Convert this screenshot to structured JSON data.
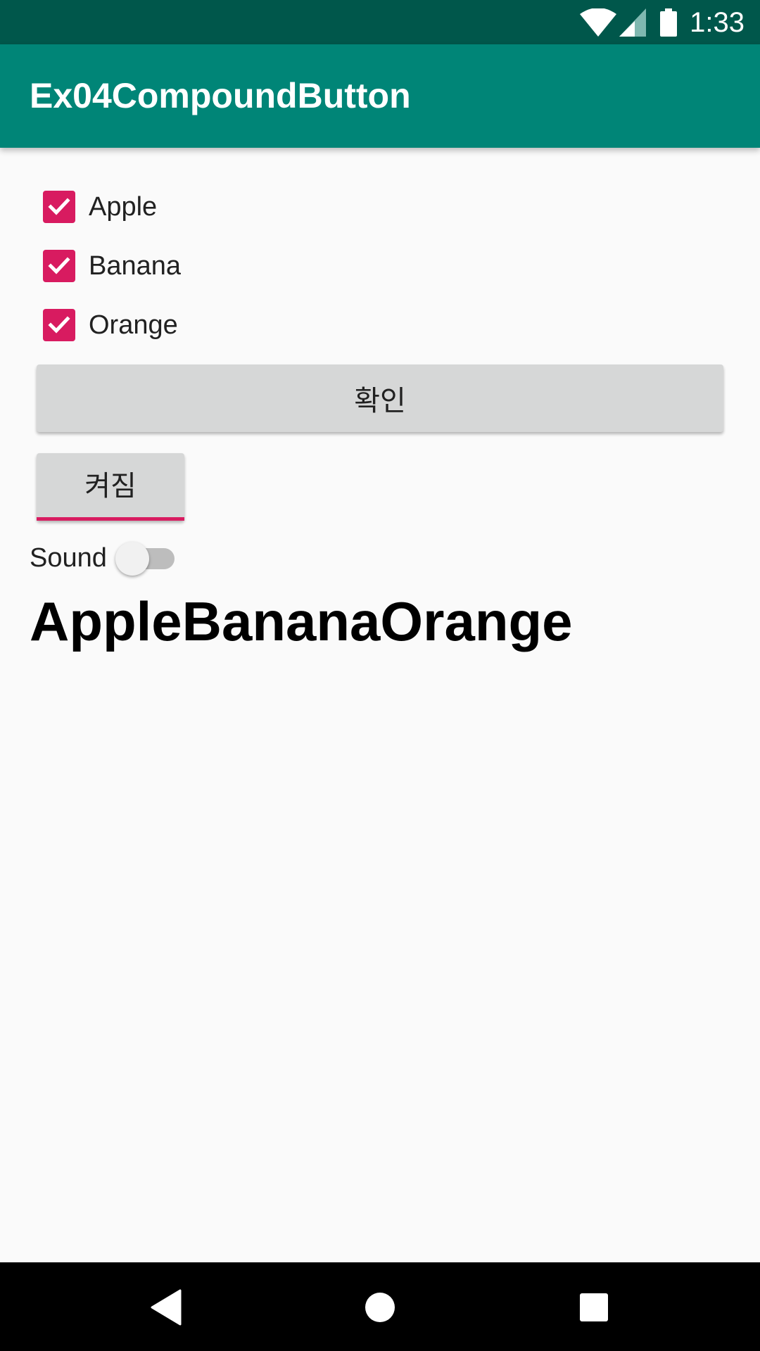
{
  "status_bar": {
    "time": "1:33",
    "icons": [
      "wifi-icon",
      "cell-signal-icon",
      "battery-icon"
    ],
    "color": "#00574b"
  },
  "app_bar": {
    "title": "Ex04CompoundButton",
    "color": "#008577"
  },
  "checkboxes": [
    {
      "label": "Apple",
      "checked": true
    },
    {
      "label": "Banana",
      "checked": true
    },
    {
      "label": "Orange",
      "checked": true
    }
  ],
  "confirm_button": {
    "label": "확인"
  },
  "toggle_button": {
    "label": "켜짐",
    "checked": true
  },
  "switch": {
    "label": "Sound",
    "checked": false
  },
  "result_text": "AppleBananaOrange",
  "accent_color": "#d81b60",
  "nav_bar": {
    "buttons": [
      "back-icon",
      "home-icon",
      "recents-icon"
    ]
  }
}
